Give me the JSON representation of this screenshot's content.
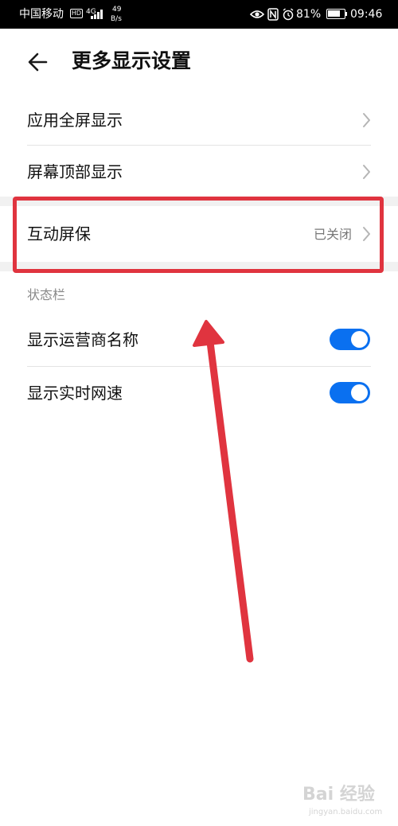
{
  "status_bar": {
    "carrier": "中国移动",
    "hd_label": "HD",
    "network_type": "4G",
    "speed_value": "49",
    "speed_unit": "B/s",
    "battery_percent": "81%",
    "battery_level": 0.81,
    "time": "09:46"
  },
  "header": {
    "title": "更多显示设置",
    "back_icon": "arrow-left-icon"
  },
  "settings": {
    "fullscreen": {
      "label": "应用全屏显示"
    },
    "top_display": {
      "label": "屏幕顶部显示"
    },
    "screensaver": {
      "label": "互动屏保",
      "value": "已关闭"
    }
  },
  "status_bar_section": {
    "header": "状态栏",
    "items": [
      {
        "label": "显示运营商名称",
        "enabled": true
      },
      {
        "label": "显示实时网速",
        "enabled": true
      }
    ]
  },
  "watermark": {
    "main": "Bai 经验",
    "sub": "jingyan.baidu.com"
  },
  "colors": {
    "accent_blue": "#0a70f0",
    "annotation_red": "#e0343f",
    "section_gap": "#f1f1f1"
  }
}
